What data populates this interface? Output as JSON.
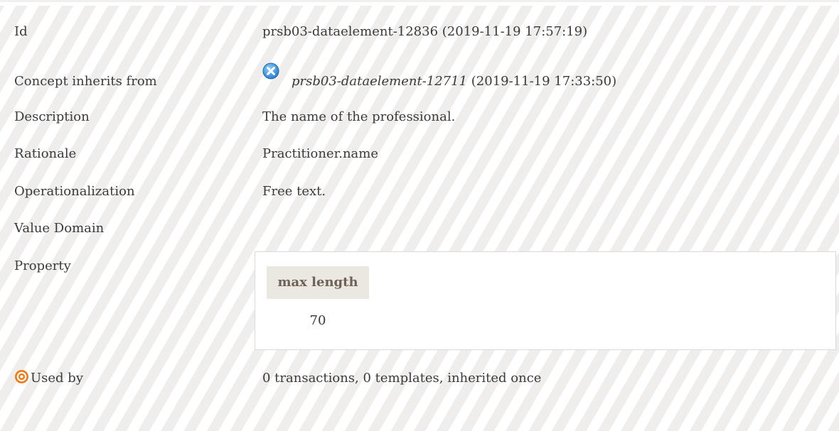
{
  "rows": {
    "id": {
      "label": "Id",
      "value": "prsb03-dataelement-12836 (2019-11-19 17:57:19)"
    },
    "inherits": {
      "label": "Concept inherits from",
      "link": "prsb03-dataelement-12711",
      "suffix": " (2019-11-19 17:33:50)",
      "icon": "inherit-x-icon"
    },
    "description": {
      "label": "Description",
      "value": "The name of the professional."
    },
    "rationale": {
      "label": "Rationale",
      "value": "Practitioner.name"
    },
    "operationalization": {
      "label": "Operationalization",
      "value": "Free text."
    },
    "value_domain": {
      "label": "Value Domain"
    },
    "property": {
      "label": "Property",
      "column_header": "max length",
      "column_value": "70"
    },
    "used_by": {
      "label": "Used by",
      "value": "0 transactions, 0 templates, inherited once",
      "icon": "target-icon"
    }
  },
  "colors": {
    "accent_orange": "#f07a1a",
    "link_blue": "#3a8fd9",
    "header_bg": "#ebe8e2"
  }
}
